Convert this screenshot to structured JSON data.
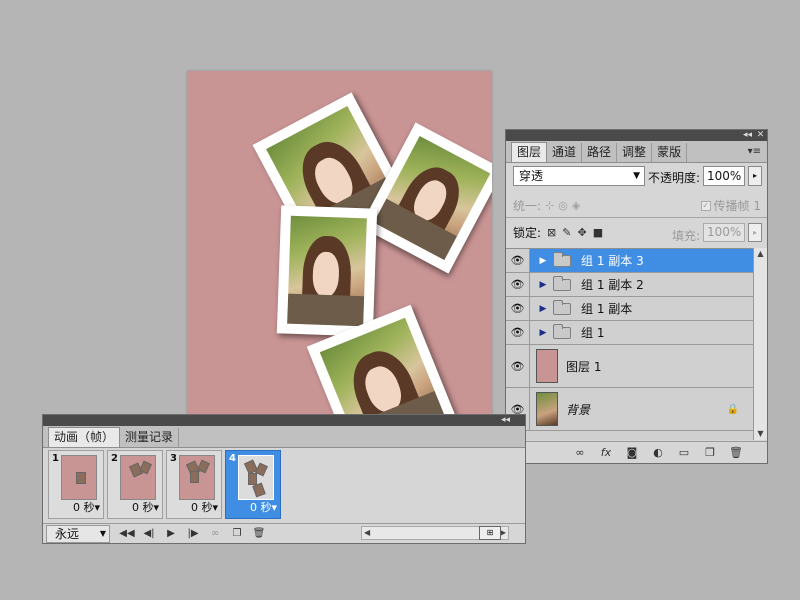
{
  "layers_panel": {
    "tabs": [
      "图层",
      "通道",
      "路径",
      "调整",
      "蒙版"
    ],
    "blend_mode": "穿透",
    "opacity_label": "不透明度:",
    "opacity_value": "100%",
    "unify_label": "统一:",
    "propagate_label": "传播帧 1",
    "lock_label": "锁定:",
    "fill_label": "填充:",
    "fill_value": "100%",
    "layers": [
      {
        "name": "组 1 副本 3",
        "type": "group",
        "selected": true
      },
      {
        "name": "组 1 副本 2",
        "type": "group",
        "selected": false
      },
      {
        "name": "组 1 副本",
        "type": "group",
        "selected": false
      },
      {
        "name": "组 1",
        "type": "group",
        "selected": false
      },
      {
        "name": "图层 1",
        "type": "layer",
        "selected": false
      },
      {
        "name": "背景",
        "type": "background",
        "selected": false,
        "locked": true
      }
    ],
    "footer_buttons": [
      "link-icon",
      "fx-icon",
      "mask-icon",
      "adjustment-icon",
      "folder-icon",
      "new-layer-icon",
      "trash-icon"
    ]
  },
  "animation_panel": {
    "tabs": [
      "动画（帧）",
      "测量记录"
    ],
    "frames": [
      {
        "number": "1",
        "delay": "0 秒",
        "selected": false
      },
      {
        "number": "2",
        "delay": "0 秒",
        "selected": false
      },
      {
        "number": "3",
        "delay": "0 秒",
        "selected": false
      },
      {
        "number": "4",
        "delay": "0 秒",
        "selected": true
      }
    ],
    "loop_option": "永远"
  },
  "colors": {
    "canvas_background": "#c99494",
    "selection": "#3f8ee3",
    "panel_background": "#d6d6d6",
    "workspace": "#b5b5b5"
  }
}
